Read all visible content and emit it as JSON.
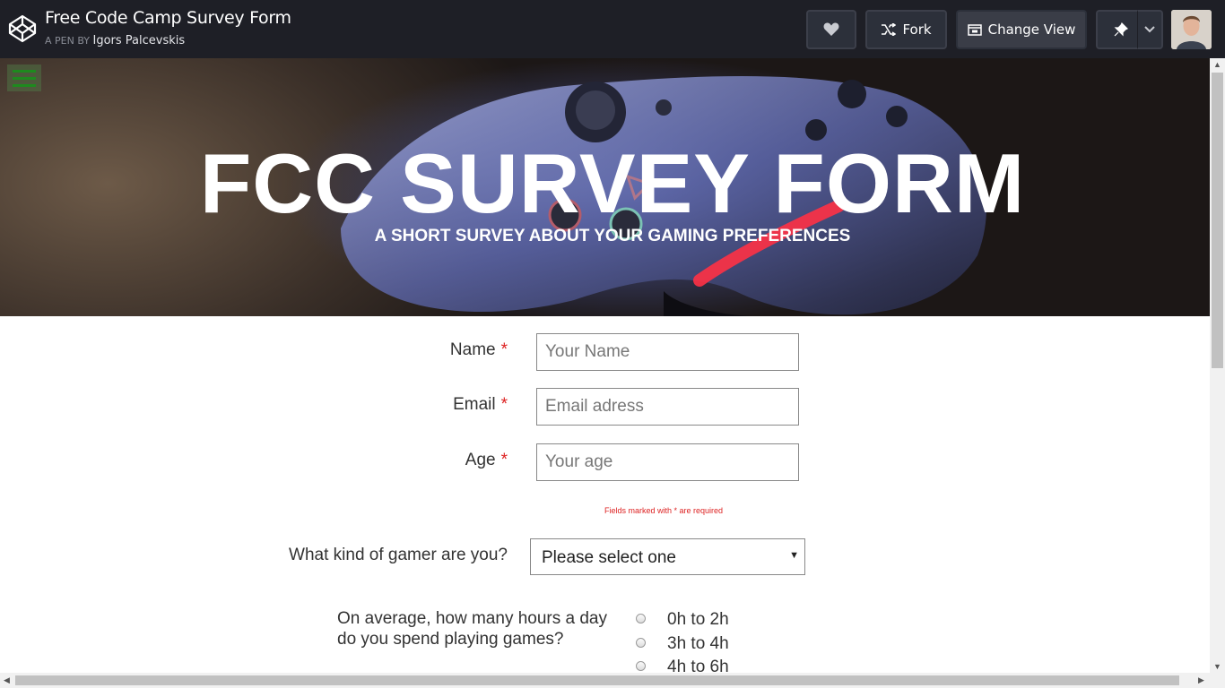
{
  "topbar": {
    "pen_title": "Free Code Camp Survey Form",
    "pen_by_prefix": "A PEN BY",
    "author": "Igors Palcevskis",
    "fork_label": "Fork",
    "change_view_label": "Change View"
  },
  "hero": {
    "title": "FCC SURVEY FORM",
    "subtitle": "A SHORT SURVEY ABOUT YOUR GAMING PREFERENCES"
  },
  "form": {
    "name_label": "Name",
    "name_placeholder": "Your Name",
    "email_label": "Email",
    "email_placeholder": "Email adress",
    "age_label": "Age",
    "age_placeholder": "Your age",
    "required_marker": "*",
    "required_note": "Fields marked with * are required",
    "gamer_question": "What kind of gamer are you?",
    "gamer_select_value": "Please select one",
    "hours_question_line1": "On average, how many hours a day",
    "hours_question_line2": "do you spend playing games?",
    "hours_options": [
      "0h to 2h",
      "3h to 4h",
      "4h to 6h"
    ]
  },
  "colors": {
    "topbar_bg": "#1e1f26",
    "required_red": "#dd2222",
    "hamburger_green": "#1e8a1e"
  },
  "icons": {
    "logo": "codepen-logo-icon",
    "like": "heart-icon",
    "fork": "fork-icon",
    "change_view": "change-view-icon",
    "pin": "pin-icon",
    "dropdown": "chevron-down-icon",
    "menu": "hamburger-menu-icon"
  }
}
